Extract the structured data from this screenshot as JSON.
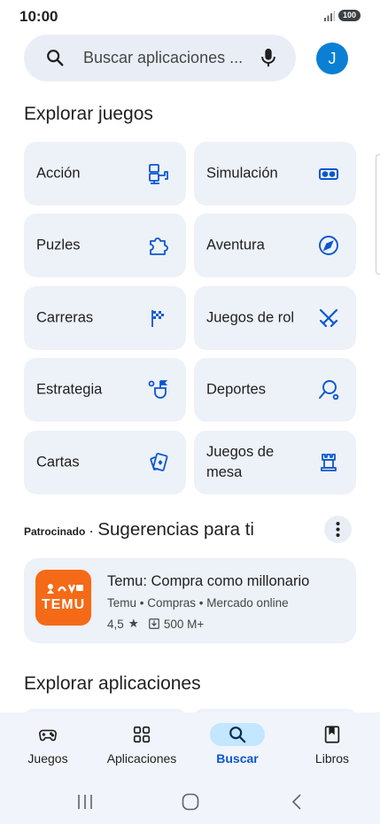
{
  "status_bar": {
    "time": "10:00",
    "battery": "100"
  },
  "search": {
    "placeholder": "Buscar aplicaciones ..."
  },
  "profile": {
    "initial": "J"
  },
  "games_section": {
    "title": "Explorar juegos",
    "categories": [
      {
        "label": "Acción",
        "icon": "helicopter-icon"
      },
      {
        "label": "Simulación",
        "icon": "vr-headset-icon"
      },
      {
        "label": "Puzles",
        "icon": "puzzle-piece-icon"
      },
      {
        "label": "Aventura",
        "icon": "compass-icon"
      },
      {
        "label": "Carreras",
        "icon": "checkered-flag-icon"
      },
      {
        "label": "Juegos de rol",
        "icon": "crossed-swords-icon"
      },
      {
        "label": "Estrategia",
        "icon": "strategy-flag-icon"
      },
      {
        "label": "Deportes",
        "icon": "racket-icon"
      },
      {
        "label": "Cartas",
        "icon": "playing-cards-icon"
      },
      {
        "label": "Juegos de mesa",
        "icon": "chess-rook-icon"
      }
    ]
  },
  "suggestions": {
    "sponsored_label": "Patrocinado",
    "title": "Sugerencias para ti",
    "app": {
      "name": "Temu: Compra como millonario",
      "icon_text": "TEMU",
      "developer": "Temu",
      "category": "Compras",
      "tag": "Mercado online",
      "rating": "4,5",
      "star": "★",
      "downloads": "500 M+"
    }
  },
  "apps_section": {
    "title": "Explorar aplicaciones"
  },
  "bottom_nav": {
    "items": [
      {
        "label": "Juegos",
        "icon": "gamepad-icon",
        "active": false
      },
      {
        "label": "Aplicaciones",
        "icon": "apps-grid-icon",
        "active": false
      },
      {
        "label": "Buscar",
        "icon": "search-icon",
        "active": true
      },
      {
        "label": "Libros",
        "icon": "book-icon",
        "active": false
      }
    ]
  },
  "colors": {
    "accent": "#0b57d0",
    "card_bg": "#edf1f8",
    "search_bg": "#e9eef6",
    "avatar": "#0b7fd4",
    "temu_orange": "#f56a16",
    "nav_active_pill": "#c2e7ff"
  }
}
